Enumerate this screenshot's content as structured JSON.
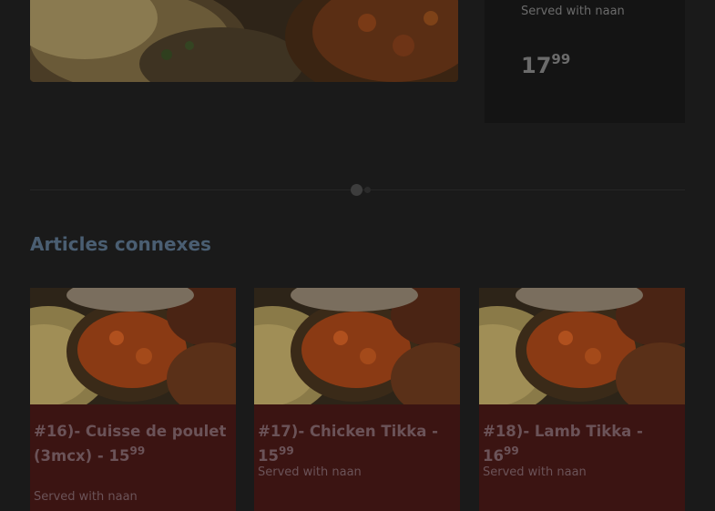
{
  "featured": {
    "note": "Served with naan",
    "price_main": "17",
    "price_cents": "99"
  },
  "slider": {
    "active_index": 0,
    "dot_count": 2
  },
  "related": {
    "title": "Articles connexes",
    "items": [
      {
        "title": "#16)- Cuisse de poulet (3mcx) - 15",
        "price_cents": "99",
        "note": "Served with naan"
      },
      {
        "title": "#17)- Chicken Tikka - 15",
        "price_cents": "99",
        "note": "Served with naan"
      },
      {
        "title": "#18)- Lamb Tikka - 16",
        "price_cents": "99",
        "note": "Served with naan"
      }
    ]
  },
  "colors": {
    "background": "#1a1a1a",
    "card": "#3b1412",
    "title_blue": "#4a5e72",
    "muted_text": "#6b6b6b"
  }
}
